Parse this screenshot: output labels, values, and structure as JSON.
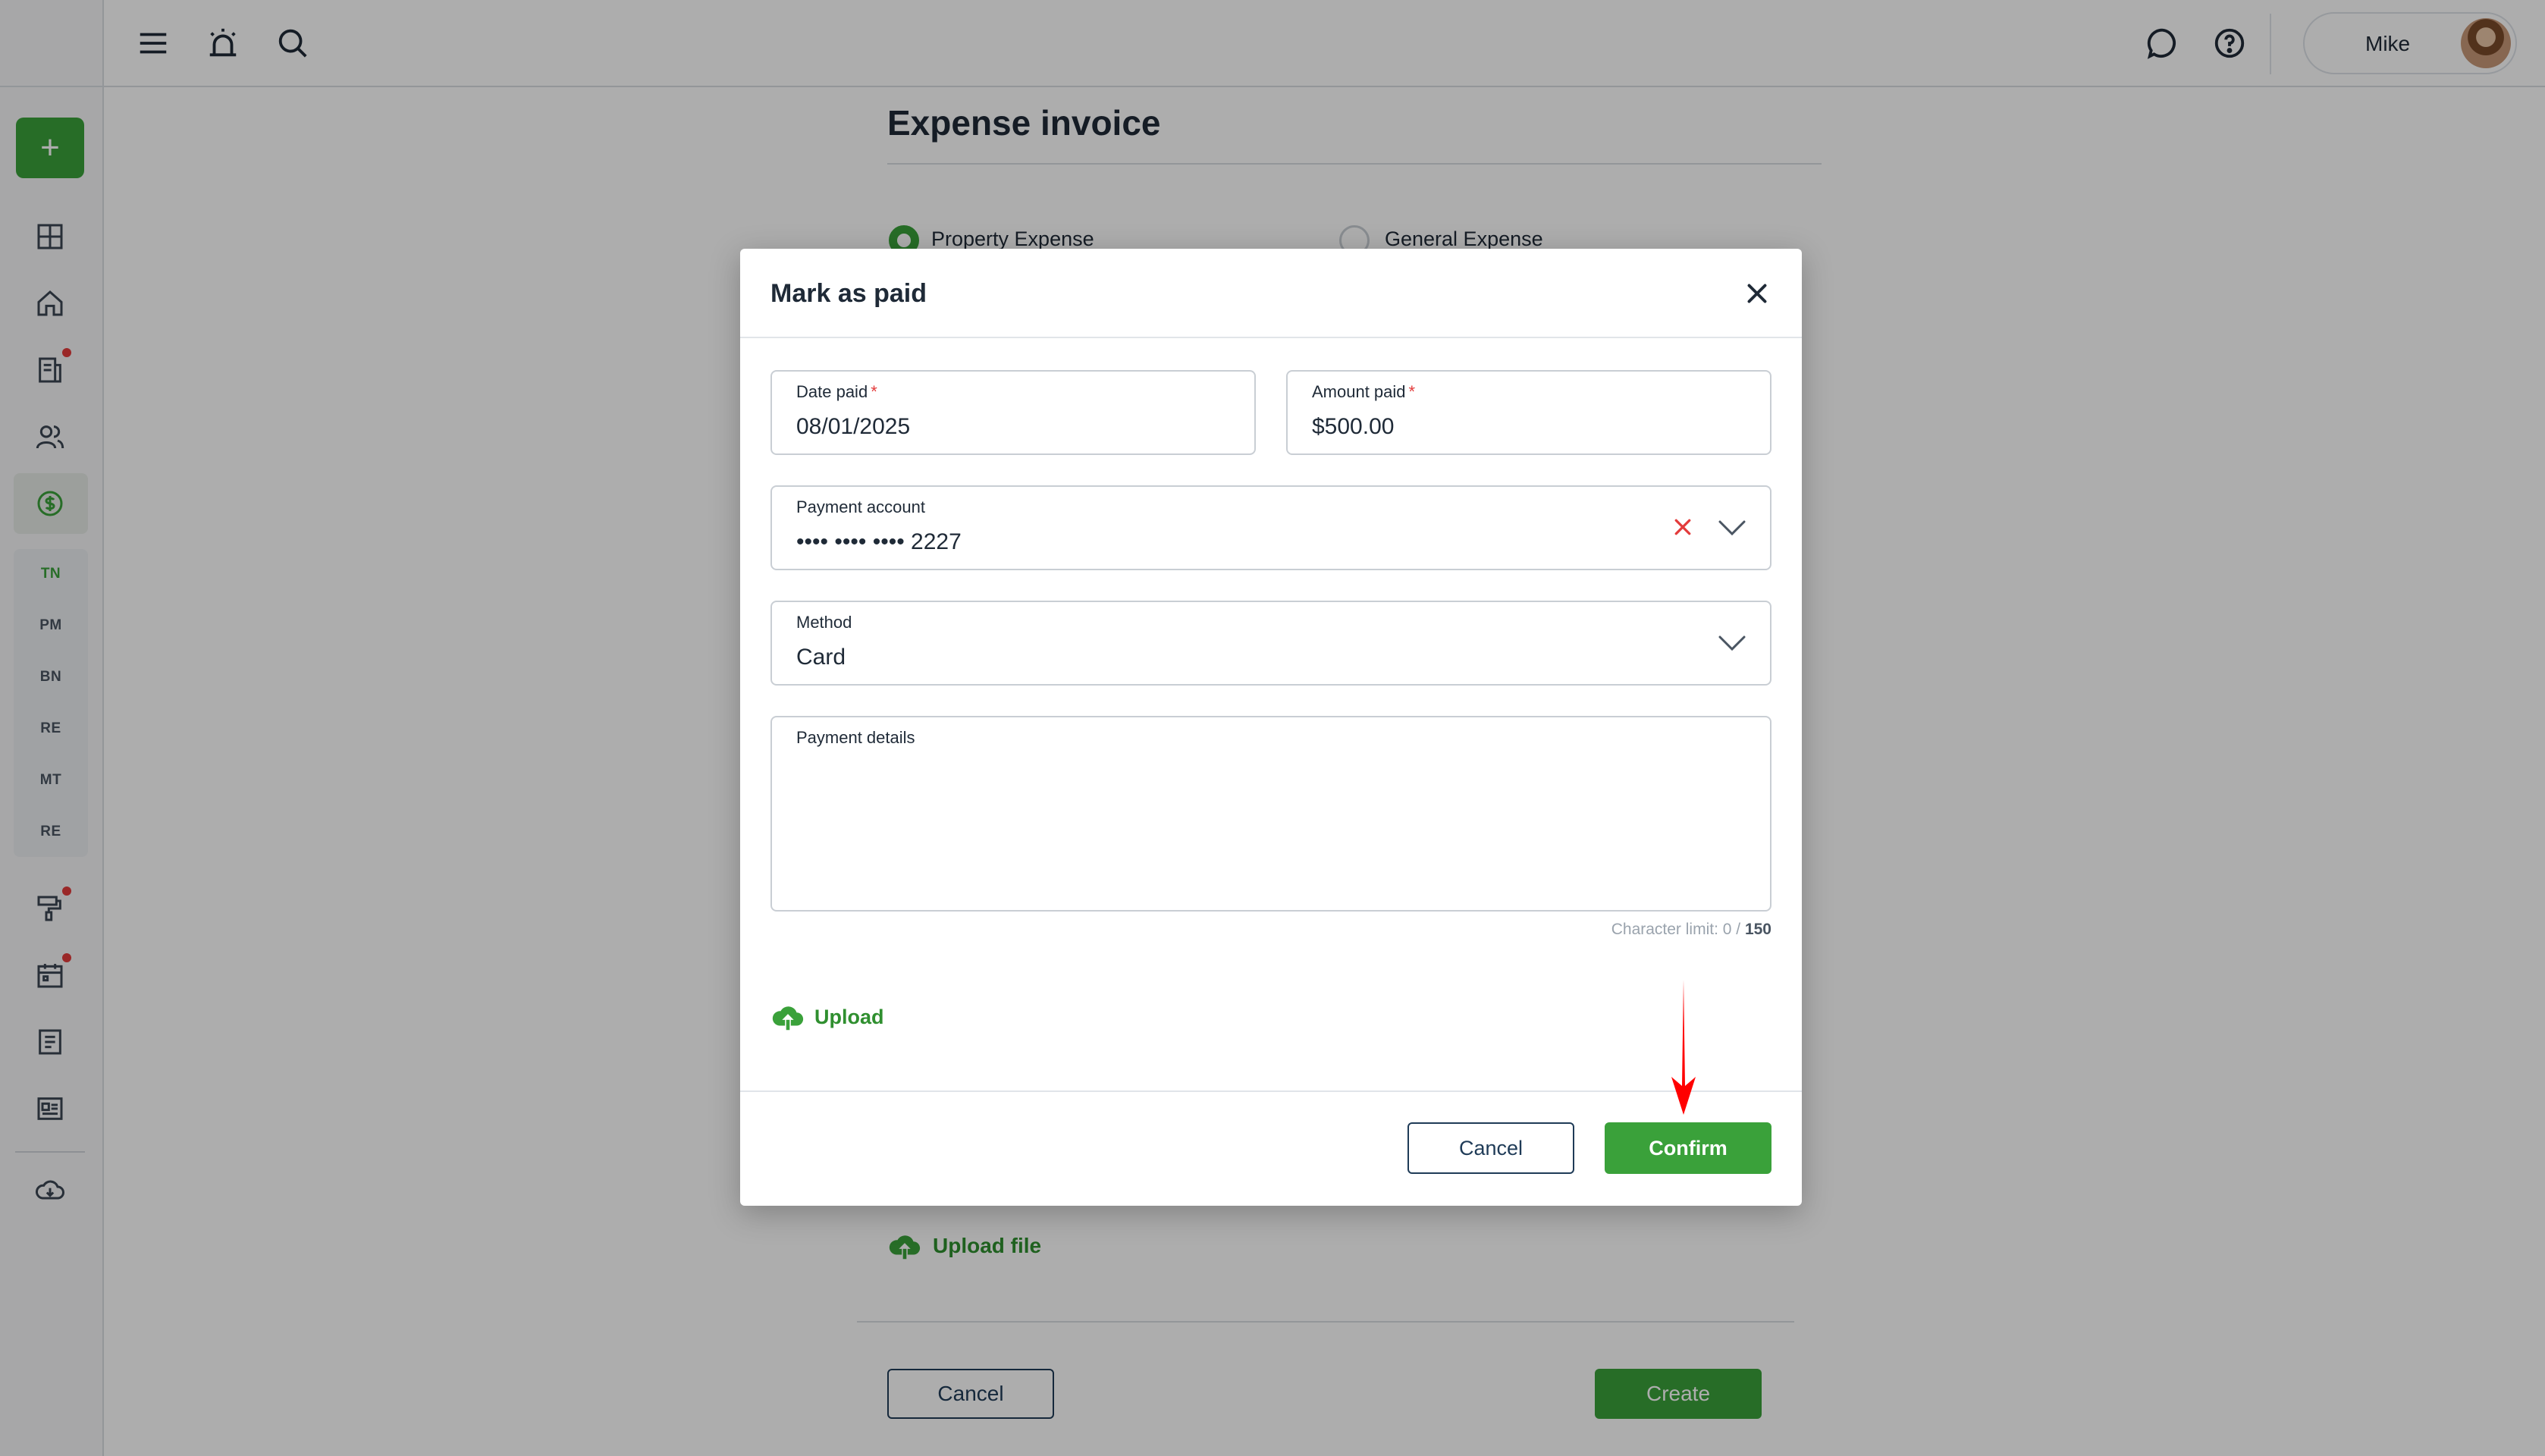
{
  "sidebar": {
    "add_label": "+",
    "items": [
      {
        "icon": "dashboard-icon"
      },
      {
        "icon": "home-icon"
      },
      {
        "icon": "documents-icon",
        "badge": true
      },
      {
        "icon": "people-icon"
      },
      {
        "icon": "finance-icon",
        "active": true
      }
    ],
    "sub_items": [
      "TN",
      "PM",
      "BN",
      "RE",
      "MT",
      "RE"
    ],
    "bottom_items": [
      {
        "icon": "paint-roller-icon",
        "badge": true
      },
      {
        "icon": "calendar-icon",
        "badge": true
      },
      {
        "icon": "notes-icon"
      },
      {
        "icon": "id-card-icon"
      },
      {
        "icon": "download-cloud-icon"
      }
    ]
  },
  "topbar": {
    "user_name": "Mike"
  },
  "page": {
    "title": "Expense invoice",
    "radio_options": [
      "Property Expense",
      "General Expense"
    ],
    "selected_radio": "Property Expense",
    "upload_file_label": "Upload file",
    "cancel_label": "Cancel",
    "create_label": "Create"
  },
  "modal": {
    "title": "Mark as paid",
    "date_paid": {
      "label": "Date paid",
      "required_mark": "*",
      "value": "08/01/2025"
    },
    "amount_paid": {
      "label": "Amount paid",
      "required_mark": "*",
      "value": "$500.00"
    },
    "payment_account": {
      "label": "Payment account",
      "value": "•••• •••• •••• 2227"
    },
    "method": {
      "label": "Method",
      "value": "Card"
    },
    "payment_details": {
      "label": "Payment details",
      "value": ""
    },
    "char_limit_prefix": "Character limit: 0 /",
    "char_limit_max": "150",
    "upload_label": "Upload",
    "cancel_label": "Cancel",
    "confirm_label": "Confirm"
  },
  "colors": {
    "accent_green": "#3aa13a",
    "badge_red": "#e33b3b",
    "arrow_red": "#ff0000",
    "navy": "#1f3b57"
  }
}
